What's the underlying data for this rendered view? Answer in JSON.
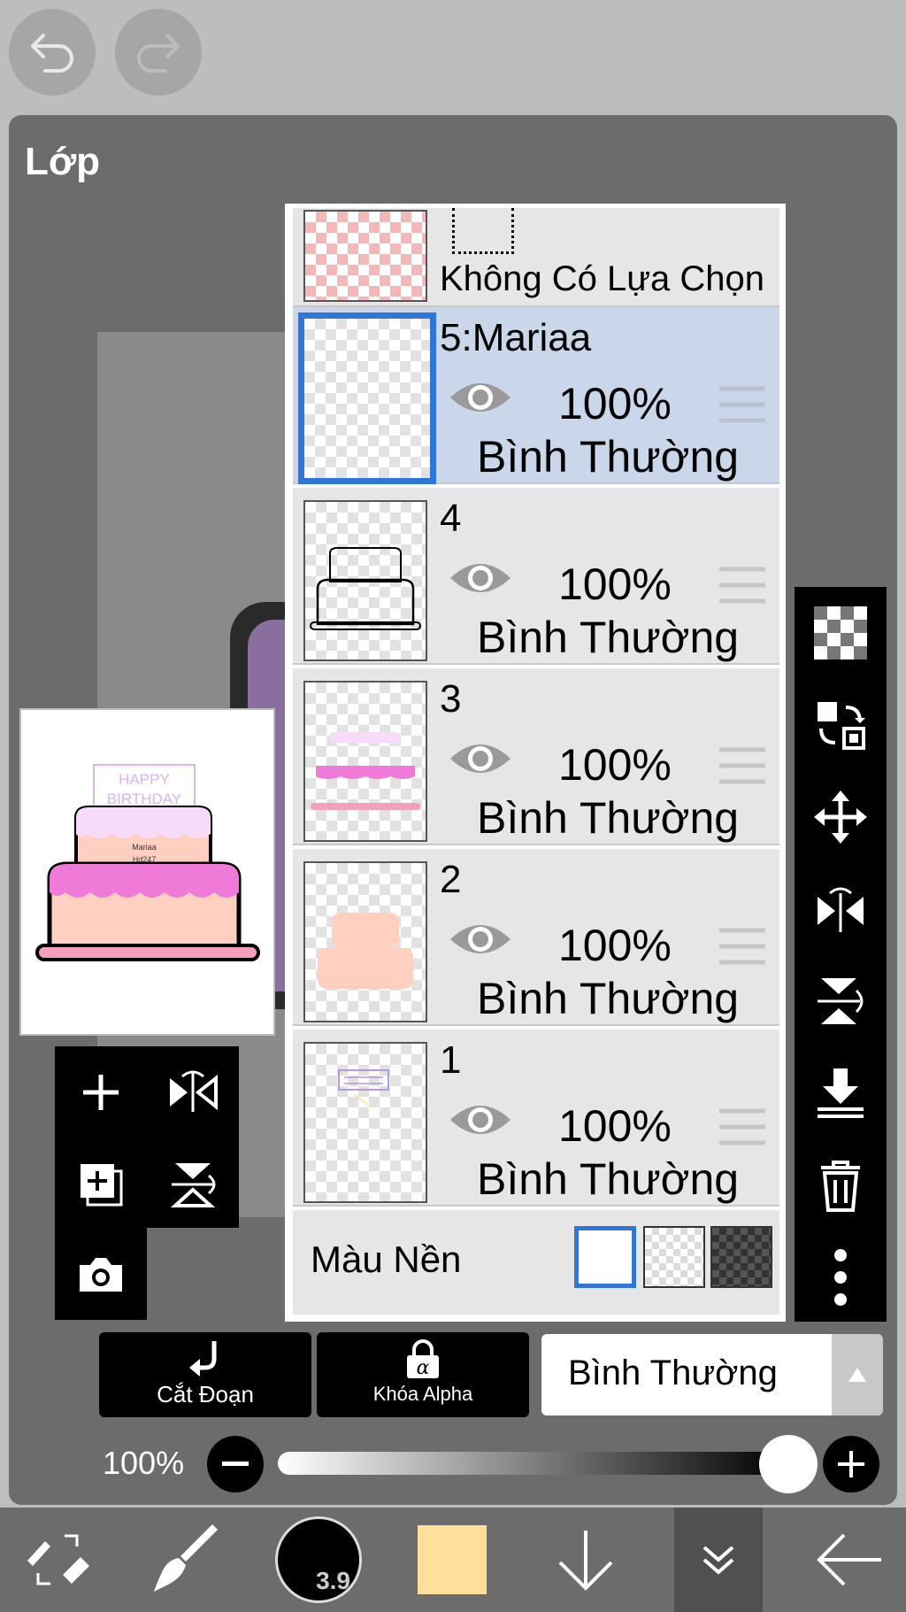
{
  "panel": {
    "title": "Lớp"
  },
  "selection_row": {
    "label": "Không Có Lựa Chọn"
  },
  "layers": [
    {
      "name": "5:Mariaa",
      "opacity": "100%",
      "blend": "Bình Thường",
      "selected": true
    },
    {
      "name": "4",
      "opacity": "100%",
      "blend": "Bình Thường",
      "selected": false
    },
    {
      "name": "3",
      "opacity": "100%",
      "blend": "Bình Thường",
      "selected": false
    },
    {
      "name": "2",
      "opacity": "100%",
      "blend": "Bình Thường",
      "selected": false
    },
    {
      "name": "1",
      "opacity": "100%",
      "blend": "Bình Thường",
      "selected": false
    }
  ],
  "background_row": {
    "label": "Màu Nền",
    "options": [
      "white",
      "transparent",
      "dark-checker"
    ],
    "selected": "white"
  },
  "thumbnail": {
    "banner_line1": "HAPPY",
    "banner_line2": "BIRTHDAY",
    "name_line1": "Mariaa",
    "name_line2": "Hd247"
  },
  "bottom_controls": {
    "clipping_label": "Cắt Đoạn",
    "alpha_lock_label": "Khóa Alpha",
    "blend_mode": "Bình Thường",
    "opacity_label": "100%",
    "opacity_value": 1.0
  },
  "brush": {
    "size_label": "3.9"
  },
  "colors": {
    "selection_blue": "#2f76d6",
    "selected_row": "#cad7ea",
    "primary_color": "#ffdf99",
    "panel": "#6c6c6c"
  }
}
